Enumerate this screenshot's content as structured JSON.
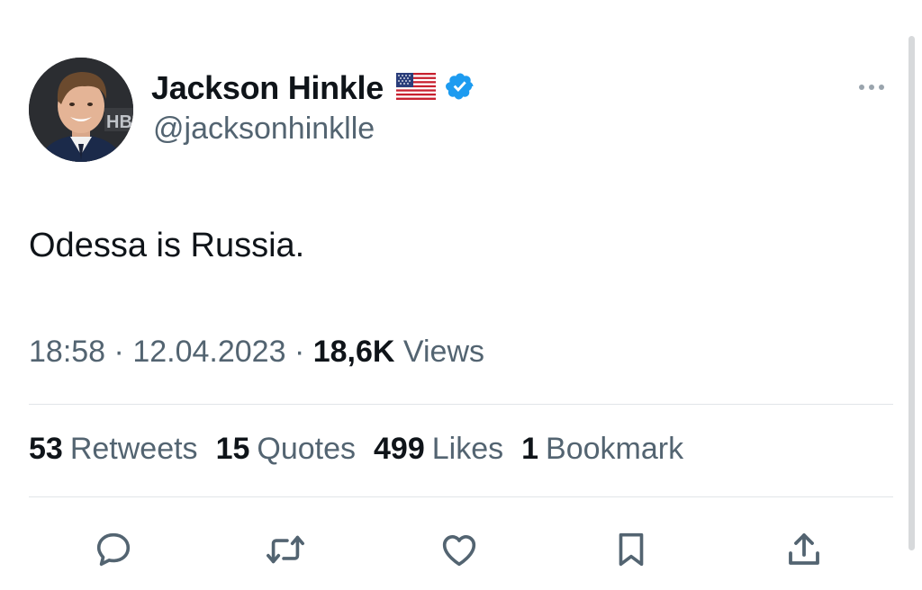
{
  "author": {
    "name": "Jackson Hinkle",
    "handle": "@jacksonhinklle",
    "flag": "us-flag-icon",
    "verified": true
  },
  "tweet": {
    "text": "Odessa is Russia.",
    "time": "18:58",
    "separator": "·",
    "date": "12.04.2023",
    "views_count": "18,6K",
    "views_label": "Views"
  },
  "stats": {
    "retweets": {
      "count": "53",
      "label": "Retweets"
    },
    "quotes": {
      "count": "15",
      "label": "Quotes"
    },
    "likes": {
      "count": "499",
      "label": "Likes"
    },
    "bookmarks": {
      "count": "1",
      "label": "Bookmark"
    }
  },
  "actions": [
    "reply-icon",
    "retweet-icon",
    "like-icon",
    "bookmark-icon",
    "share-icon"
  ],
  "colors": {
    "text": "#0f1419",
    "secondary": "#536471",
    "verified": "#1d9bf0",
    "divider": "#e1e5e8"
  }
}
